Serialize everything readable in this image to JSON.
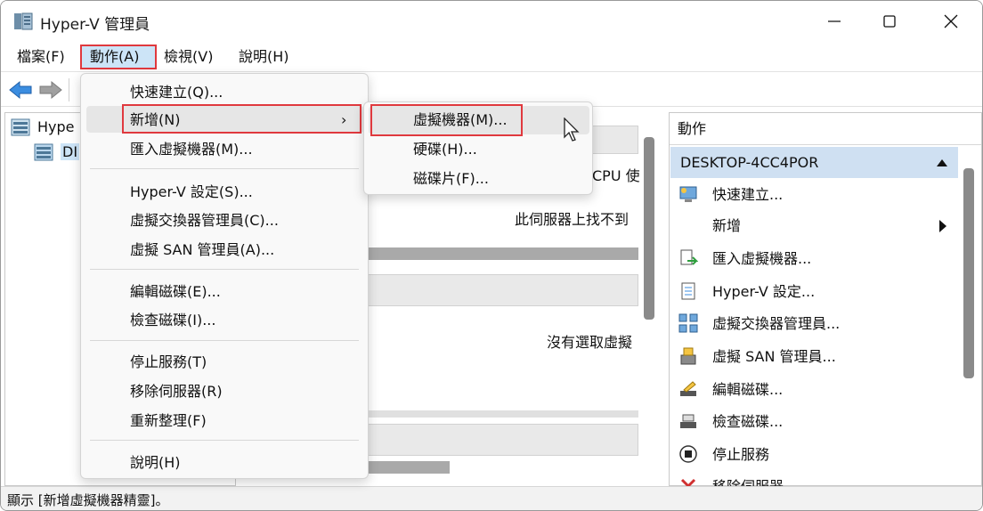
{
  "window": {
    "title": "Hyper-V 管理員"
  },
  "menubar": {
    "file": "檔案(F)",
    "action": "動作(A)",
    "view": "檢視(V)",
    "help": "說明(H)"
  },
  "left_tree": {
    "root": "Hype",
    "child": "DI"
  },
  "center": {
    "cpu_text": "CPU 使",
    "no_vm_text": "此伺服器上找不到",
    "no_select_text": "沒有選取虛擬"
  },
  "action_menu": {
    "items": [
      "快速建立(Q)...",
      "新增(N)",
      "匯入虛擬機器(M)...",
      "Hyper-V 設定(S)...",
      "虛擬交換器管理員(C)...",
      "虛擬 SAN 管理員(A)...",
      "編輯磁碟(E)...",
      "檢查磁碟(I)...",
      "停止服務(T)",
      "移除伺服器(R)",
      "重新整理(F)",
      "說明(H)"
    ],
    "submenu_arrow": "›"
  },
  "new_submenu": {
    "items": [
      "虛擬機器(M)...",
      "硬碟(H)...",
      "磁碟片(F)..."
    ]
  },
  "right_pane": {
    "header": "動作",
    "section": "DESKTOP-4CC4POR",
    "items": [
      "快速建立...",
      "新增",
      "匯入虛擬機器...",
      "Hyper-V 設定...",
      "虛擬交換器管理員...",
      "虛擬 SAN 管理員...",
      "編輯磁碟...",
      "檢查磁碟...",
      "停止服務",
      "移除伺服器"
    ]
  },
  "statusbar": {
    "text": "顯示 [新增虛擬機器精靈]。"
  },
  "icons": {
    "back": "back-arrow-icon",
    "forward": "forward-arrow-icon",
    "app": "hyperv-server-icon"
  },
  "colors": {
    "highlight_border": "#e0393e",
    "menu_selected": "#cce4f7",
    "section_bg": "#cfe0f2"
  }
}
